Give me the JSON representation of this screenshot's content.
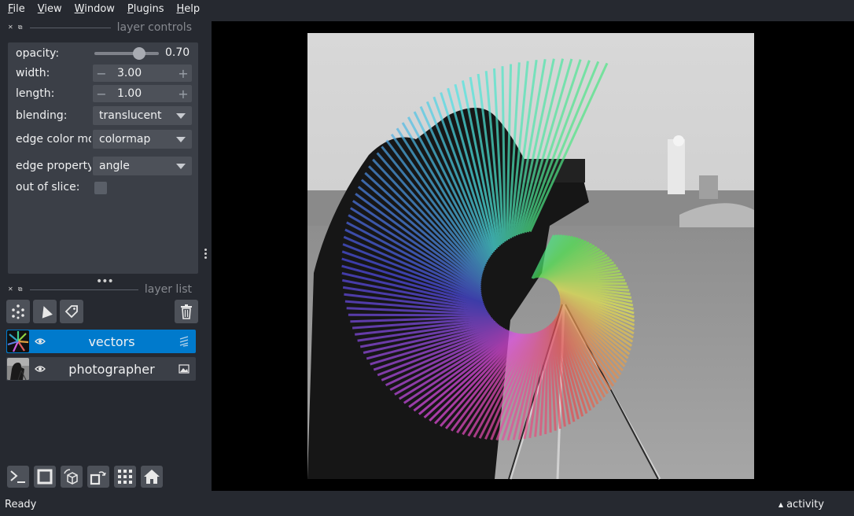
{
  "menu": [
    "File",
    "View",
    "Window",
    "Plugins",
    "Help"
  ],
  "menu_mnemonics": [
    "F",
    "V",
    "W",
    "P",
    "H"
  ],
  "layer_controls": {
    "title": "layer controls",
    "opacity_label": "opacity:",
    "opacity_value": "0.70",
    "opacity_fraction": 0.7,
    "width_label": "width:",
    "width_value": "3.00",
    "length_label": "length:",
    "length_value": "1.00",
    "blending_label": "blending:",
    "blending_value": "translucent",
    "edge_color_mode_label": "edge color mode:",
    "edge_color_mode_value": "colormap",
    "edge_property_label": "edge property:",
    "edge_property_value": "angle",
    "out_of_slice_label": "out of slice:",
    "out_of_slice_checked": false
  },
  "layer_list": {
    "title": "layer list",
    "layers": [
      {
        "name": "vectors",
        "visible": true,
        "selected": true,
        "type": "vectors"
      },
      {
        "name": "photographer",
        "visible": true,
        "selected": false,
        "type": "image"
      }
    ]
  },
  "status": {
    "text": "Ready",
    "activity": "activity"
  },
  "colors": {
    "background": "#262930",
    "panel": "#3b3f47",
    "selected": "#007acc"
  }
}
